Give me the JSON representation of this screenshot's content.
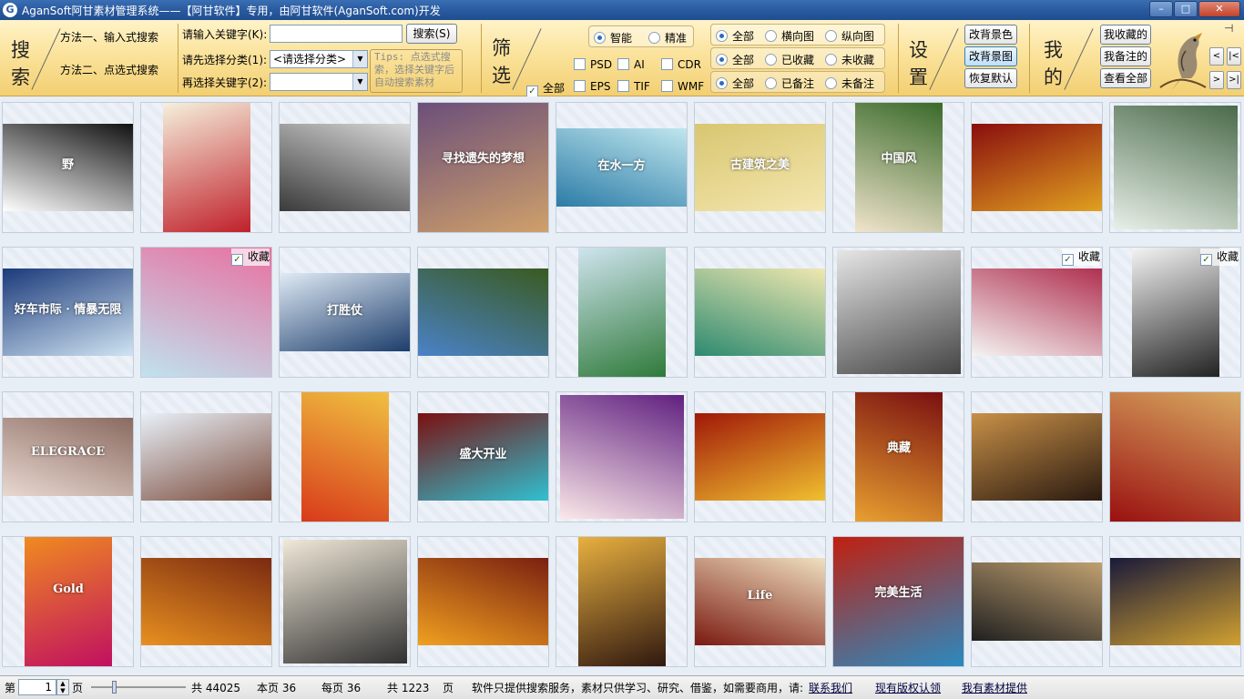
{
  "window": {
    "title": "AganSoft阿甘素材管理系统——【阿甘软件】专用，由阿甘软件(AganSoft.com)开发",
    "app_icon": "G",
    "buttons": {
      "minimize": "–",
      "maximize": "□",
      "close": "✕"
    }
  },
  "search": {
    "section_label": "搜索",
    "method1": "方法一、输入式搜索",
    "method2": "方法二、点选式搜索",
    "keyword_label": "请输入关键字(K):",
    "keyword_value": "",
    "search_button": "搜索(S)",
    "category_label": "请先选择分类(1):",
    "category_value": "<请选择分类>",
    "keyword2_label": "再选择关键字(2):",
    "keyword2_value": "",
    "tips": "Tips: 点选式搜索，选择关键字后自动搜索素材"
  },
  "filter": {
    "section_label": "筛选",
    "mode_smart": "智能",
    "mode_exact": "精准",
    "all_label": "全部",
    "formats": [
      "PSD",
      "AI",
      "CDR",
      "EPS",
      "TIF",
      "WMF"
    ],
    "orientation": [
      "全部",
      "横向图",
      "纵向图"
    ],
    "favorites": [
      "全部",
      "已收藏",
      "未收藏"
    ],
    "notes": [
      "全部",
      "已备注",
      "未备注"
    ]
  },
  "settings": {
    "section_label": "设置",
    "change_bg_color": "改背景色",
    "change_bg_image": "改背景图",
    "restore_default": "恢复默认"
  },
  "mine": {
    "section_label": "我的",
    "my_favorites": "我收藏的",
    "my_notes": "我备注的",
    "view_all": "查看全部"
  },
  "nav": {
    "prev": "<",
    "first": "|<",
    "next": ">",
    "last": ">|",
    "pin": "⊣"
  },
  "fav_label": "收藏",
  "thumbs": [
    {
      "colors": [
        "#ffffff",
        "#111111"
      ],
      "text": "野",
      "fav": false
    },
    {
      "colors": [
        "#f5f0dc",
        "#c0202a"
      ],
      "text": "",
      "fav": false
    },
    {
      "colors": [
        "#3a3a3a",
        "#d8d8d8"
      ],
      "text": "",
      "fav": false
    },
    {
      "colors": [
        "#6b4f7a",
        "#cfa06a"
      ],
      "text": "寻找遗失的梦想",
      "fav": false
    },
    {
      "colors": [
        "#2c7ca7",
        "#bfe6ee"
      ],
      "text": "在水一方",
      "fav": false
    },
    {
      "colors": [
        "#d8c670",
        "#f4e7b0"
      ],
      "text": "古建筑之美",
      "fav": false
    },
    {
      "colors": [
        "#f1e4cc",
        "#3a6a2a"
      ],
      "text": "中国风",
      "fav": false
    },
    {
      "colors": [
        "#8a0e0e",
        "#e0a020"
      ],
      "text": "",
      "fav": false
    },
    {
      "colors": [
        "#e8efe8",
        "#4a6a4a"
      ],
      "text": "",
      "fav": false
    },
    {
      "colors": [
        "#1b3a7a",
        "#cfe3f2"
      ],
      "text": "好车市际 · 情暴无限",
      "fav": false
    },
    {
      "colors": [
        "#bfe3ef",
        "#e870a0"
      ],
      "text": "",
      "fav": true
    },
    {
      "colors": [
        "#dfeaf5",
        "#1c3d6b"
      ],
      "text": "打胜仗",
      "fav": false
    },
    {
      "colors": [
        "#4a82c8",
        "#3a5a20"
      ],
      "text": "",
      "fav": false
    },
    {
      "colors": [
        "#cfe4ef",
        "#2f7a3a"
      ],
      "text": "",
      "fav": false
    },
    {
      "colors": [
        "#2d8a70",
        "#f0e8b0"
      ],
      "text": "",
      "fav": false
    },
    {
      "colors": [
        "#e6e6e6",
        "#444444"
      ],
      "text": "",
      "fav": false
    },
    {
      "colors": [
        "#f4f4f2",
        "#b03050"
      ],
      "text": "",
      "fav": true
    },
    {
      "colors": [
        "#f4f4f4",
        "#222222"
      ],
      "text": "",
      "fav": true
    },
    {
      "colors": [
        "#e8d8d0",
        "#8a6a60"
      ],
      "text": "ELEGRACE",
      "fav": false
    },
    {
      "colors": [
        "#e8f0f8",
        "#7a4a3a"
      ],
      "text": "",
      "fav": false
    },
    {
      "colors": [
        "#d83a1a",
        "#f0c040"
      ],
      "text": "",
      "fav": false
    },
    {
      "colors": [
        "#7a1010",
        "#30c0d0"
      ],
      "text": "盛大开业",
      "fav": false
    },
    {
      "colors": [
        "#fbe8e8",
        "#602080"
      ],
      "text": "",
      "fav": false
    },
    {
      "colors": [
        "#a01808",
        "#f0c030"
      ],
      "text": "",
      "fav": false
    },
    {
      "colors": [
        "#e8a030",
        "#7a1010"
      ],
      "text": "典藏",
      "fav": false
    },
    {
      "colors": [
        "#c89048",
        "#2a1a10"
      ],
      "text": "",
      "fav": false
    },
    {
      "colors": [
        "#9a1010",
        "#d8a860"
      ],
      "text": "",
      "fav": false
    },
    {
      "colors": [
        "#f08a20",
        "#c01060"
      ],
      "text": "Gold",
      "fav": false
    },
    {
      "colors": [
        "#e89020",
        "#7a2a10"
      ],
      "text": "",
      "fav": false
    },
    {
      "colors": [
        "#f0e8d8",
        "#303030"
      ],
      "text": "",
      "fav": false
    },
    {
      "colors": [
        "#f0a020",
        "#7a2010"
      ],
      "text": "",
      "fav": false
    },
    {
      "colors": [
        "#e8b040",
        "#301810"
      ],
      "text": "",
      "fav": false
    },
    {
      "colors": [
        "#7a1a10",
        "#f0e0c0"
      ],
      "text": "Life",
      "fav": false
    },
    {
      "colors": [
        "#c02010",
        "#2a8ac0"
      ],
      "text": "完美生活",
      "fav": false
    },
    {
      "colors": [
        "#202020",
        "#c0a070"
      ],
      "text": "",
      "fav": false
    },
    {
      "colors": [
        "#1a1a3a",
        "#d0a030"
      ],
      "text": "",
      "fav": false
    }
  ],
  "status": {
    "page_prefix": "第",
    "page_value": "1",
    "page_suffix": "页",
    "total_pages": "共 44025",
    "this_page": "本页 36",
    "per_page": "每页 36",
    "total_count": "共 1223",
    "count_suffix": "页",
    "notice": "软件只提供搜索服务，素材只供学习、研究、借鉴，如需要商用，请:",
    "contact": "联系我们",
    "report": "现有版权认领",
    "provide": "我有素材提供"
  }
}
